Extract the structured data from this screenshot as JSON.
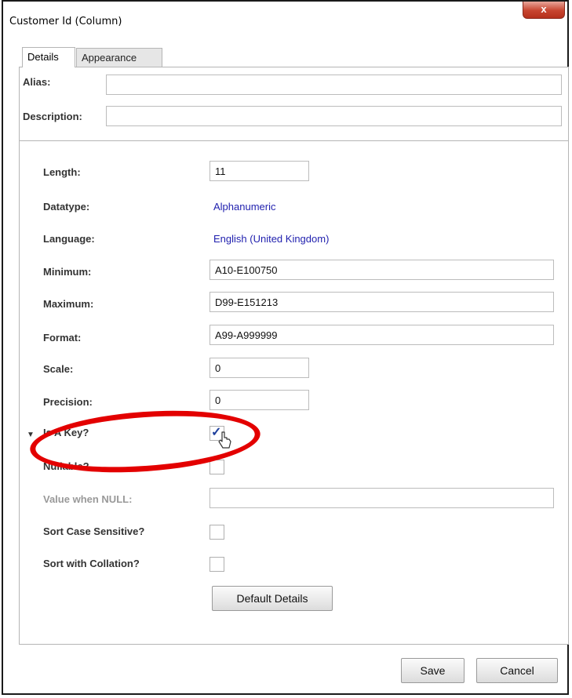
{
  "window": {
    "title": "Customer Id (Column)",
    "close_label": "x"
  },
  "tabs": [
    {
      "label": "Details",
      "active": true
    },
    {
      "label": "Appearance",
      "active": false
    }
  ],
  "top": {
    "alias_label": "Alias:",
    "alias_value": "",
    "description_label": "Description:",
    "description_value": ""
  },
  "fields": {
    "length": {
      "label": "Length:",
      "value": "11"
    },
    "datatype": {
      "label": "Datatype:",
      "value": "Alphanumeric"
    },
    "language": {
      "label": "Language:",
      "value": "English (United Kingdom)"
    },
    "minimum": {
      "label": "Minimum:",
      "value": "A10-E100750"
    },
    "maximum": {
      "label": "Maximum:",
      "value": "D99-E151213"
    },
    "format": {
      "label": "Format:",
      "value": "A99-A999999"
    },
    "scale": {
      "label": "Scale:",
      "value": "0"
    },
    "precision": {
      "label": "Precision:",
      "value": "0"
    },
    "is_a_key": {
      "label": "Is A Key?",
      "checked": true
    },
    "nullable": {
      "label": "Nullable?",
      "checked": false
    },
    "value_when_null": {
      "label": "Value when NULL:",
      "value": ""
    },
    "sort_case_sensitive": {
      "label": "Sort Case Sensitive?",
      "checked": false
    },
    "sort_with_collation": {
      "label": "Sort with Collation?",
      "checked": false
    }
  },
  "buttons": {
    "default_details": "Default Details",
    "save": "Save",
    "cancel": "Cancel"
  },
  "colors": {
    "highlight": "#e30000",
    "link_value": "#1f1fae"
  }
}
